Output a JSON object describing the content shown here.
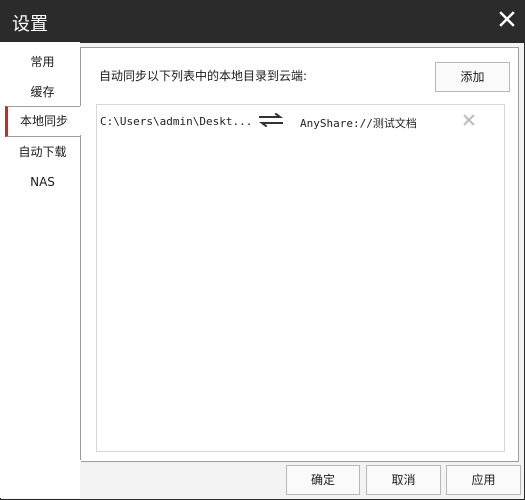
{
  "window": {
    "title": "设置"
  },
  "sidebar": {
    "items": [
      {
        "label": "常用"
      },
      {
        "label": "缓存"
      },
      {
        "label": "本地同步",
        "active": true
      },
      {
        "label": "自动下载"
      },
      {
        "label": "NAS"
      }
    ]
  },
  "main": {
    "description": "自动同步以下列表中的本地目录到云端:",
    "add_label": "添加",
    "sync_rows": [
      {
        "local_path": "C:\\Users\\admin\\Deskt...",
        "cloud_path": "AnyShare://测试文档"
      }
    ]
  },
  "footer": {
    "ok_label": "确定",
    "cancel_label": "取消",
    "apply_label": "应用"
  },
  "icons": {
    "close": "close-icon",
    "sync": "sync-arrows-icon",
    "remove": "remove-icon"
  },
  "colors": {
    "titlebar": "#2b2b2b",
    "active_accent": "#c9282d"
  }
}
